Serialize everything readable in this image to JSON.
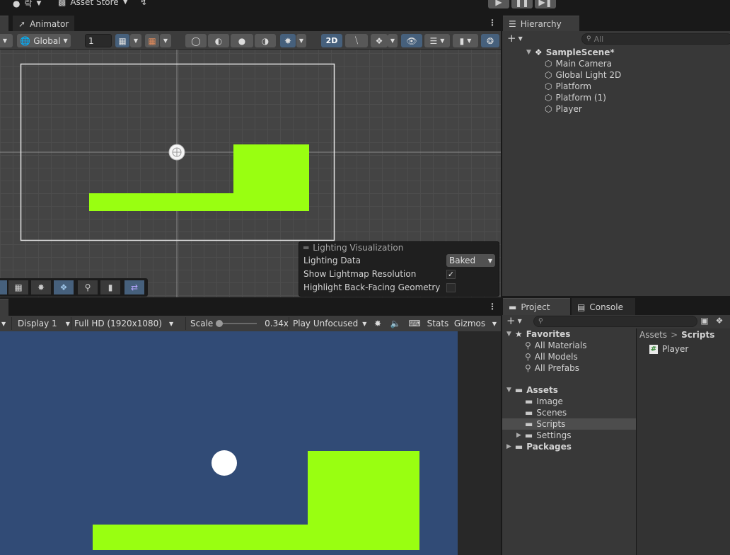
{
  "top_bar": {
    "asset_store_label": "Asset Store",
    "account_label": "락"
  },
  "scene_panel": {
    "tab_label": "Animator",
    "toolbar": {
      "pivot_space": "Global",
      "grid_value": "1",
      "mode_2d": "2D"
    },
    "lighting_visualization": {
      "title": "Lighting Visualization",
      "rows": [
        {
          "label": "Lighting Data",
          "value": "Baked"
        },
        {
          "label": "Show Lightmap Resolution",
          "checked": true
        },
        {
          "label": "Highlight Back-Facing Geometry",
          "checked": false
        }
      ]
    },
    "colors": {
      "platform": "#99ff11",
      "background": "#444444"
    }
  },
  "game_panel": {
    "toolbar": {
      "display": "Display 1",
      "resolution": "Full HD (1920x1080)",
      "scale_label": "Scale",
      "scale_value": "0.34x",
      "play_mode": "Play Unfocused",
      "stats_label": "Stats",
      "gizmos_label": "Gizmos"
    },
    "colors": {
      "sky": "#314b76",
      "platform": "#99ff11",
      "ball": "#ffffff"
    }
  },
  "hierarchy": {
    "tab_label": "Hierarchy",
    "search_placeholder": "All",
    "scene_name": "SampleScene*",
    "items": [
      "Main Camera",
      "Global Light 2D",
      "Platform",
      "Platform (1)",
      "Player"
    ]
  },
  "project": {
    "tabs": [
      "Project",
      "Console"
    ],
    "favorites_label": "Favorites",
    "favorites": [
      "All Materials",
      "All Models",
      "All Prefabs"
    ],
    "assets_label": "Assets",
    "asset_folders": [
      "Image",
      "Scenes",
      "Scripts",
      "Settings"
    ],
    "packages_label": "Packages",
    "breadcrumb": [
      "Assets",
      "Scripts"
    ],
    "files": [
      "Player"
    ]
  }
}
